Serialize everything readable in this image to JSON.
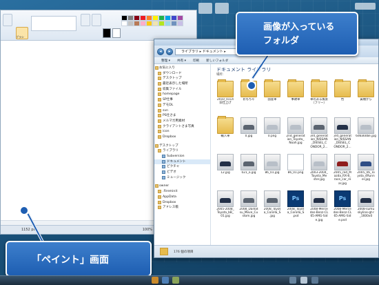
{
  "paint": {
    "brush_label": "ブラシ",
    "status_text": "1152",
    "status_unit": "px",
    "zoom": "100%",
    "palette": [
      "#000000",
      "#7f7f7f",
      "#880015",
      "#ed1c24",
      "#ff7f27",
      "#fff200",
      "#22b14c",
      "#00a2e8",
      "#3f48cc",
      "#a349a4",
      "#ffffff",
      "#c3c3c3",
      "#b97a57",
      "#ffaec9",
      "#ffc90e",
      "#efe4b0",
      "#b5e61d",
      "#99d9ea",
      "#7092be",
      "#c8bfe7"
    ]
  },
  "explorer": {
    "address": "ライブラリ ▸ ドキュメント ▸",
    "commands": [
      "整理 ▾",
      "共有 ▾",
      "印刷",
      "新しいフォルダ"
    ],
    "nav": [
      {
        "label": "お気に入り",
        "type": "root"
      },
      {
        "label": "ダウンロード",
        "type": "item"
      },
      {
        "label": "デスクトップ",
        "type": "item"
      },
      {
        "label": "最近表示した場所",
        "type": "item"
      },
      {
        "label": "収集ファイル",
        "type": "item"
      },
      {
        "label": "homepage",
        "type": "item"
      },
      {
        "label": "SP仕事",
        "type": "item"
      },
      {
        "label": "デモDL",
        "type": "item"
      },
      {
        "label": "svn",
        "type": "item"
      },
      {
        "label": "PS仕さま",
        "type": "item"
      },
      {
        "label": "メルマガ用素材",
        "type": "item"
      },
      {
        "label": "クライアントさま写真",
        "type": "item"
      },
      {
        "label": "icon",
        "type": "item"
      },
      {
        "label": "Dropbox",
        "type": "item"
      },
      {
        "label": "",
        "type": "gap"
      },
      {
        "label": "デスクトップ",
        "type": "root"
      },
      {
        "label": "ライブラリ",
        "type": "item"
      },
      {
        "label": "Subversion",
        "type": "sub"
      },
      {
        "label": "ドキュメント",
        "type": "sub",
        "selected": true
      },
      {
        "label": "ピクチャ",
        "type": "sub"
      },
      {
        "label": "ビデオ",
        "type": "sub"
      },
      {
        "label": "ミュージック",
        "type": "sub"
      },
      {
        "label": "",
        "type": "gap"
      },
      {
        "label": "owner",
        "type": "root"
      },
      {
        "label": ".Fireminit",
        "type": "item"
      },
      {
        "label": "AppData",
        "type": "item"
      },
      {
        "label": "Dropbox",
        "type": "item"
      },
      {
        "label": "アドレス帳",
        "type": "item"
      }
    ],
    "library_title": "ドキュメント ライブラリ",
    "library_sub": "場所:",
    "items": [
      {
        "caption": "2010_0114\n旧仕上げ",
        "kind": "folder"
      },
      {
        "caption": "おもちゃ",
        "kind": "folder"
      },
      {
        "caption": "国産車",
        "kind": "folder"
      },
      {
        "caption": "事故車",
        "kind": "folder"
      },
      {
        "caption": "車のある風景\n（フリー）",
        "kind": "folder"
      },
      {
        "caption": "色",
        "kind": "folder"
      },
      {
        "caption": "貴種から",
        "kind": "folder"
      },
      {
        "caption": "輸入車",
        "kind": "folder"
      },
      {
        "caption": "0.jpg",
        "kind": "photo",
        "variant": "c1"
      },
      {
        "caption": "0.png",
        "kind": "photo",
        "variant": "c2"
      },
      {
        "caption": "2nd_generat\nion_Toyota_\nNoah.jpg",
        "kind": "photo",
        "variant": "c2"
      },
      {
        "caption": "3rd_generat\nion_NISSAN\n_DIESEL_C\nONDOR_2...",
        "kind": "photo",
        "variant": "c1"
      },
      {
        "caption": "3rd_generat\nion_NISSAN\n_DIESEL_C\nONDOR_2...",
        "kind": "photo",
        "variant": "c3"
      },
      {
        "caption": "6d6a60be.jpg",
        "kind": "photo",
        "variant": "c2"
      },
      {
        "caption": "12.jpg",
        "kind": "photo",
        "variant": "c3"
      },
      {
        "caption": "021_o.jpg",
        "kind": "photo",
        "variant": "c1"
      },
      {
        "caption": "86_01.jpg",
        "kind": "photo",
        "variant": "c2"
      },
      {
        "caption": "86_01.png",
        "kind": "white"
      },
      {
        "caption": "2003-2004_\nToyota_Me\nster.jpg",
        "kind": "photo",
        "variant": "c2"
      },
      {
        "caption": "2005_red_M\nazda_RX-8_\nrace_car_re\nar.jpg",
        "kind": "photo",
        "variant": "c4"
      },
      {
        "caption": "2005_V6_To\nyota_4Runn\ner.jpg",
        "kind": "photo",
        "variant": "c5"
      },
      {
        "caption": "2005-2008_\nToyota_bB_\n01.jpg",
        "kind": "photo",
        "variant": "c3"
      },
      {
        "caption": "2008_Daihat\nsu_Move_Cu\nstom.jpg",
        "kind": "photo",
        "variant": "c1"
      },
      {
        "caption": "2008_Toyot\na_Corolla_S\n.jpg",
        "kind": "photo",
        "variant": "c1"
      },
      {
        "caption": "2008_Toyot\na_Corolla_S\n.psd",
        "kind": "psd"
      },
      {
        "caption": "2008-Merce\ndes-Benz-CL\n65-AMG-Sid\ne.jpg",
        "kind": "photo",
        "variant": "c3"
      },
      {
        "caption": "2008-Merce\ndes-Benz-CL\n65-AMG-Sid\ne.psd",
        "kind": "psd"
      },
      {
        "caption": "2008-sumu\nskyline-gt-r\n_1600x0",
        "kind": "photo",
        "variant": "c3"
      }
    ],
    "status": "176 個の項目"
  },
  "callouts": {
    "folder": "画像が入っている\nフォルダ",
    "paint": "「ペイント」画面"
  },
  "colors": {
    "callout": "#1e5eb2",
    "desktop": "#1c557f"
  }
}
